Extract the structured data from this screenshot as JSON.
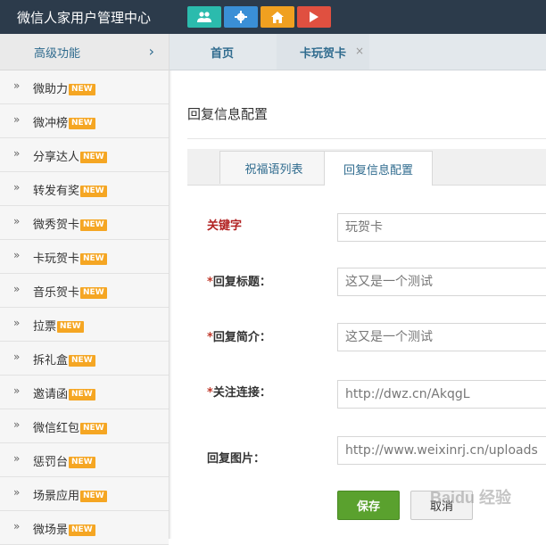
{
  "header": {
    "title": "微信人家用户管理中心",
    "buttons": [
      {
        "icon": "users-icon",
        "color": "#2bbbad"
      },
      {
        "icon": "gear-icon",
        "color": "#3a8fd6"
      },
      {
        "icon": "home-icon",
        "color": "#f0a020"
      },
      {
        "icon": "play-icon",
        "color": "#e05040"
      }
    ]
  },
  "sidebar": {
    "heading": "高级功能",
    "badge_text": "NEW",
    "items": [
      {
        "label": "微助力",
        "badge": true
      },
      {
        "label": "微冲榜",
        "badge": true
      },
      {
        "label": "分享达人",
        "badge": true
      },
      {
        "label": "转发有奖",
        "badge": true
      },
      {
        "label": "微秀贺卡",
        "badge": true
      },
      {
        "label": "卡玩贺卡",
        "badge": true
      },
      {
        "label": "音乐贺卡",
        "badge": true
      },
      {
        "label": "拉票",
        "badge": true
      },
      {
        "label": "拆礼盒",
        "badge": true
      },
      {
        "label": "邀请函",
        "badge": true
      },
      {
        "label": "微信红包",
        "badge": true
      },
      {
        "label": "惩罚台",
        "badge": true
      },
      {
        "label": "场景应用",
        "badge": true
      },
      {
        "label": "微场景",
        "badge": true
      }
    ]
  },
  "tabs": {
    "home": "首页",
    "active": "卡玩贺卡",
    "close": "×"
  },
  "panel": {
    "title": "回复信息配置",
    "subtabs": [
      "祝福语列表",
      "回复信息配置"
    ]
  },
  "form": {
    "keyword_label": "关键字",
    "keyword_value": "玩贺卡",
    "title_label": "回复标题：",
    "title_value": "这又是一个测试",
    "summary_label": "回复简介：",
    "summary_value": "这又是一个测试",
    "link_label": "关注连接：",
    "link_value": "http://dwz.cn/AkqgL",
    "image_label": "回复图片：",
    "image_value": "http://www.weixinrj.cn/uploads",
    "required_mark": "*",
    "save": "保存",
    "cancel": "取消"
  },
  "watermark": "Baidu 经验"
}
